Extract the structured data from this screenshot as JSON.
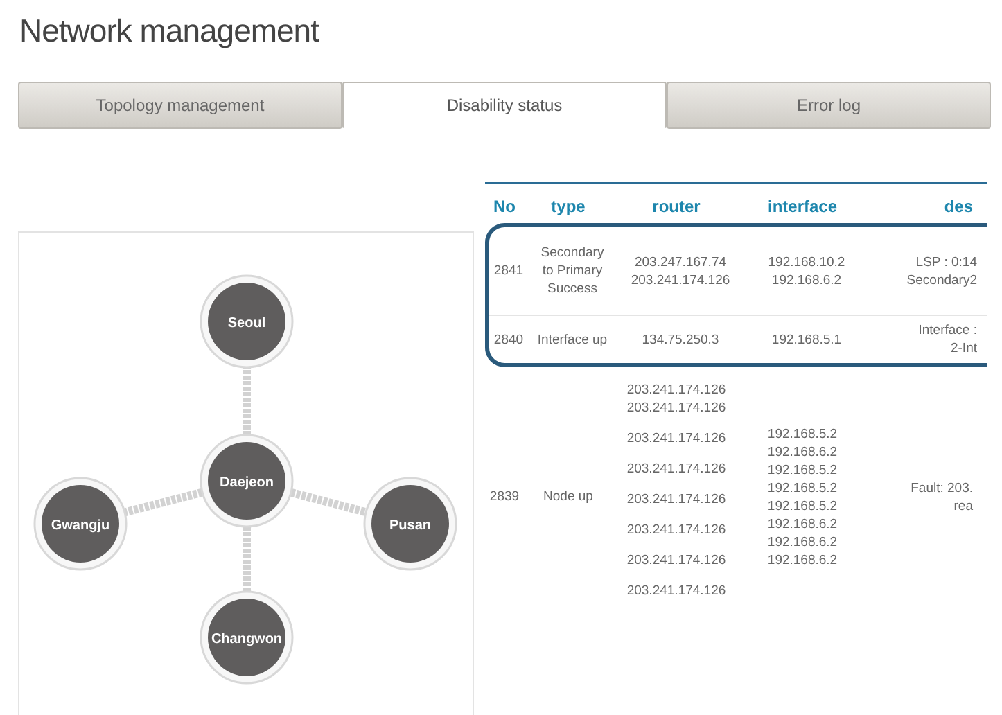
{
  "page_title": "Network management",
  "tabs": [
    {
      "label": "Topology management",
      "selected": false
    },
    {
      "label": "Disability status",
      "selected": true
    },
    {
      "label": "Error log",
      "selected": false
    }
  ],
  "topology": {
    "nodes": [
      {
        "name": "Seoul"
      },
      {
        "name": "Daejeon"
      },
      {
        "name": "Gwangju"
      },
      {
        "name": "Pusan"
      },
      {
        "name": "Changwon"
      }
    ]
  },
  "table": {
    "columns": [
      "No",
      "type",
      "router",
      "interface",
      "des"
    ],
    "rows": [
      {
        "no": "2841",
        "type": [
          "Secondary",
          "to Primary",
          "Success"
        ],
        "router": [
          "203.247.167.74",
          "203.241.174.126"
        ],
        "interface": [
          "192.168.10.2",
          "192.168.6.2"
        ],
        "description": [
          "LSP : 0:14",
          "Secondary2"
        ],
        "highlighted": true
      },
      {
        "no": "2840",
        "type": [
          "Interface up"
        ],
        "router": [
          "134.75.250.3"
        ],
        "interface": [
          "192.168.5.1"
        ],
        "description": [
          "Interface :",
          "2-Int"
        ],
        "highlighted": true
      },
      {
        "no": "2839",
        "type": [
          "Node up"
        ],
        "router": [
          "203.241.174.126",
          "203.241.174.126",
          "203.241.174.126",
          "203.241.174.126",
          "203.241.174.126",
          "203.241.174.126",
          "203.241.174.126",
          "203.241.174.126"
        ],
        "interface": [
          "192.168.5.2",
          "192.168.6.2",
          "192.168.5.2",
          "192.168.5.2",
          "192.168.5.2",
          "192.168.6.2",
          "192.168.6.2",
          "192.168.6.2"
        ],
        "description": [
          "Fault: 203.",
          "rea"
        ],
        "highlighted": false
      }
    ]
  }
}
